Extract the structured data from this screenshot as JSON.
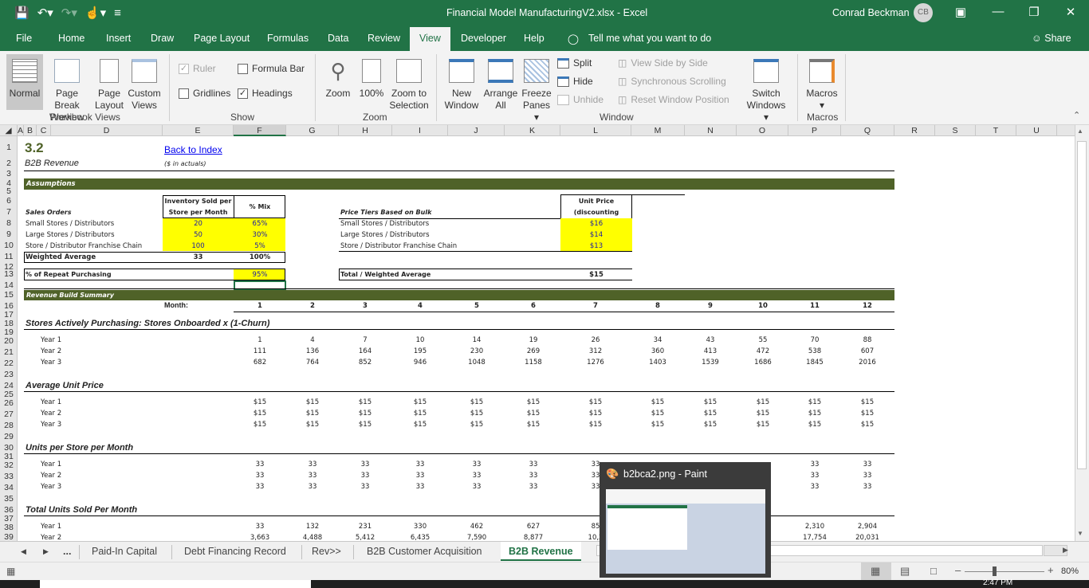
{
  "titlebar": {
    "title": "Financial Model ManufacturingV2.xlsx  -  Excel",
    "user": "Conrad Beckman",
    "user_initials": "CB"
  },
  "menu": {
    "items": [
      "File",
      "Home",
      "Insert",
      "Draw",
      "Page Layout",
      "Formulas",
      "Data",
      "Review",
      "View",
      "Developer",
      "Help"
    ],
    "active": "View",
    "tell_me": "Tell me what you want to do",
    "share": "Share"
  },
  "ribbon": {
    "workbook_views": {
      "label": "Workbook Views",
      "normal": "Normal",
      "page_break_1": "Page Break",
      "page_break_2": "Preview",
      "page_layout_1": "Page",
      "page_layout_2": "Layout",
      "custom_1": "Custom",
      "custom_2": "Views"
    },
    "show": {
      "label": "Show",
      "ruler": "Ruler",
      "formula_bar": "Formula Bar",
      "gridlines": "Gridlines",
      "headings": "Headings",
      "ruler_checked": true,
      "formula_bar_checked": false,
      "gridlines_checked": false,
      "headings_checked": true
    },
    "zoom": {
      "label": "Zoom",
      "zoom": "Zoom",
      "hundred": "100%",
      "zoom_sel_1": "Zoom to",
      "zoom_sel_2": "Selection"
    },
    "window": {
      "label": "Window",
      "new_1": "New",
      "new_2": "Window",
      "arrange_1": "Arrange",
      "arrange_2": "All",
      "freeze_1": "Freeze",
      "freeze_2": "Panes",
      "split": "Split",
      "hide": "Hide",
      "unhide": "Unhide",
      "side_by_side": "View Side by Side",
      "sync_scroll": "Synchronous Scrolling",
      "reset_pos": "Reset Window Position",
      "switch_1": "Switch",
      "switch_2": "Windows"
    },
    "macros": {
      "label": "Macros",
      "macros": "Macros"
    }
  },
  "columns": [
    "A",
    "B",
    "C",
    "D",
    "E",
    "F",
    "G",
    "H",
    "I",
    "J",
    "K",
    "L",
    "M",
    "N",
    "O",
    "P",
    "Q",
    "R",
    "S",
    "T",
    "U"
  ],
  "rows": [
    "1",
    "2",
    "3",
    "4",
    "5",
    "6",
    "7",
    "8",
    "9",
    "10",
    "11",
    "12",
    "13",
    "14",
    "15",
    "16",
    "17",
    "18",
    "19",
    "20",
    "21",
    "22",
    "23",
    "24",
    "25",
    "26",
    "27",
    "28",
    "29",
    "30",
    "31",
    "32",
    "33",
    "34",
    "35",
    "36",
    "37",
    "38",
    "39"
  ],
  "sheet": {
    "section_num": "3.2",
    "section_title": "B2B Revenue",
    "back_link": "Back to Index",
    "units_note": "($ in actuals)",
    "assumptions_band": "Assumptions",
    "sales_orders": {
      "header": "Sales Orders",
      "col1_header_1": "Inventory Sold per",
      "col1_header_2": "Store per Month",
      "col2_header": "% Mix",
      "rows": [
        {
          "label": "Small Stores / Distributors",
          "inventory": "20",
          "mix": "65%"
        },
        {
          "label": "Large Stores / Distributors",
          "inventory": "50",
          "mix": "30%"
        },
        {
          "label": "Store / Distributor Franchise Chain",
          "inventory": "100",
          "mix": "5%"
        }
      ],
      "weighted_label": "Weighted Average",
      "weighted_inventory": "33",
      "weighted_mix": "100%",
      "repeat_label": "% of Repeat Purchasing",
      "repeat_value": "95%"
    },
    "price_tiers": {
      "header": "Price Tiers Based on Bulk",
      "col_header_1": "Unit Price",
      "col_header_2": "(discounting",
      "rows": [
        {
          "label": "Small Stores / Distributors",
          "price": "$16"
        },
        {
          "label": "Large Stores / Distributors",
          "price": "$14"
        },
        {
          "label": "Store / Distributor Franchise Chain",
          "price": "$13"
        }
      ],
      "total_label": "Total / Weighted Average",
      "total_value": "$15"
    },
    "revenue_band": "Revenue Build Summary",
    "month_label": "Month:",
    "months": [
      "1",
      "2",
      "3",
      "4",
      "5",
      "6",
      "7",
      "8",
      "9",
      "10",
      "11",
      "12"
    ],
    "sections": [
      {
        "title": "Stores Actively Purchasing: Stores Onboarded x (1-Churn)",
        "rows": [
          {
            "label": "Year 1",
            "values": [
              "1",
              "4",
              "7",
              "10",
              "14",
              "19",
              "26",
              "34",
              "43",
              "55",
              "70",
              "88"
            ]
          },
          {
            "label": "Year 2",
            "values": [
              "111",
              "136",
              "164",
              "195",
              "230",
              "269",
              "312",
              "360",
              "413",
              "472",
              "538",
              "607"
            ]
          },
          {
            "label": "Year 3",
            "values": [
              "682",
              "764",
              "852",
              "946",
              "1048",
              "1158",
              "1276",
              "1403",
              "1539",
              "1686",
              "1845",
              "2016"
            ]
          }
        ]
      },
      {
        "title": "Average Unit Price",
        "rows": [
          {
            "label": "Year 1",
            "values": [
              "$15",
              "$15",
              "$15",
              "$15",
              "$15",
              "$15",
              "$15",
              "$15",
              "$15",
              "$15",
              "$15",
              "$15"
            ]
          },
          {
            "label": "Year 2",
            "values": [
              "$15",
              "$15",
              "$15",
              "$15",
              "$15",
              "$15",
              "$15",
              "$15",
              "$15",
              "$15",
              "$15",
              "$15"
            ]
          },
          {
            "label": "Year 3",
            "values": [
              "$15",
              "$15",
              "$15",
              "$15",
              "$15",
              "$15",
              "$15",
              "$15",
              "$15",
              "$15",
              "$15",
              "$15"
            ]
          }
        ]
      },
      {
        "title": "Units per Store per Month",
        "rows": [
          {
            "label": "Year 1",
            "values": [
              "33",
              "33",
              "33",
              "33",
              "33",
              "33",
              "33",
              "",
              "",
              "",
              "33",
              "33"
            ]
          },
          {
            "label": "Year 2",
            "values": [
              "33",
              "33",
              "33",
              "33",
              "33",
              "33",
              "33",
              "",
              "",
              "",
              "33",
              "33"
            ]
          },
          {
            "label": "Year 3",
            "values": [
              "33",
              "33",
              "33",
              "33",
              "33",
              "33",
              "33",
              "",
              "",
              "",
              "33",
              "33"
            ]
          }
        ]
      },
      {
        "title": "Total Units Sold Per Month",
        "rows": [
          {
            "label": "Year 1",
            "values": [
              "33",
              "132",
              "231",
              "330",
              "462",
              "627",
              "85",
              "",
              "",
              "",
              "2,310",
              "2,904"
            ]
          },
          {
            "label": "Year 2",
            "values": [
              "3,663",
              "4,488",
              "5,412",
              "6,435",
              "7,590",
              "8,877",
              "10,2",
              "",
              "",
              "",
              "17,754",
              "20,031"
            ]
          }
        ]
      }
    ]
  },
  "tabs": {
    "items": [
      "Paid-In Capital",
      "Debt Financing Record",
      "Rev>>",
      "B2B Customer Acquisition",
      "B2B Revenue"
    ],
    "active": "B2B Revenue",
    "more": "..."
  },
  "status": {
    "zoom": "80%",
    "zoom_fraction": 0.5
  },
  "taskbar": {
    "time": "2:47 PM"
  },
  "popup": {
    "title": "b2bca2.png - Paint"
  }
}
